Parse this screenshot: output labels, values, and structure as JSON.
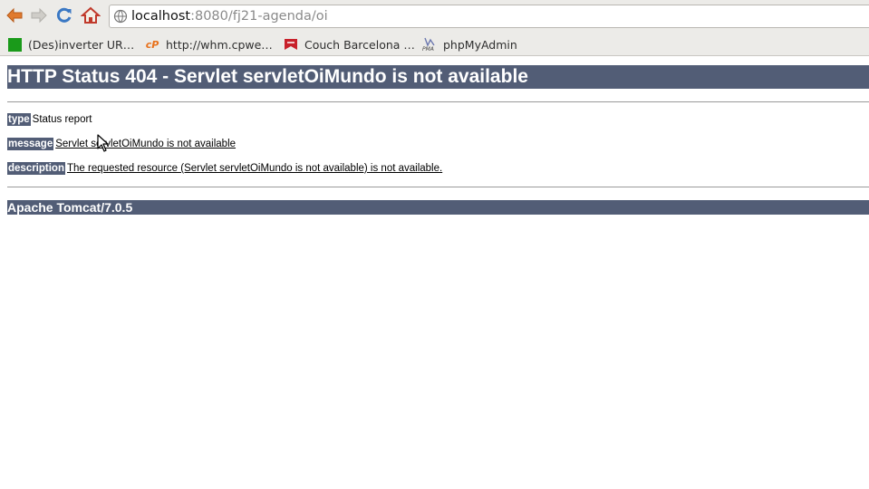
{
  "browser": {
    "url_host": "localhost",
    "url_rest": ":8080/fj21-agenda/oi",
    "bookmarks": [
      {
        "label": "(Des)inverter UR…",
        "icon": "green-square-icon",
        "color": "#1a9a1a"
      },
      {
        "label": "http://whm.cpwe…",
        "icon": "cpanel-icon",
        "color": "#e8721c"
      },
      {
        "label": "Couch Barcelona …",
        "icon": "couch-icon",
        "color": "#c8202a"
      },
      {
        "label": "phpMyAdmin",
        "icon": "phpmyadmin-icon",
        "color": "#6c78af"
      }
    ]
  },
  "page": {
    "title": "HTTP Status 404 - Servlet servletOiMundo is not available",
    "rows": [
      {
        "label": "type",
        "value": "Status report"
      },
      {
        "label": "message",
        "value": "Servlet servletOiMundo is not available"
      },
      {
        "label": "description",
        "value": "The requested resource (Servlet servletOiMundo is not available) is not available."
      }
    ],
    "footer": "Apache Tomcat/7.0.5"
  },
  "colors": {
    "header_bg": "#525d76",
    "chrome_bg": "#ecebe8"
  }
}
